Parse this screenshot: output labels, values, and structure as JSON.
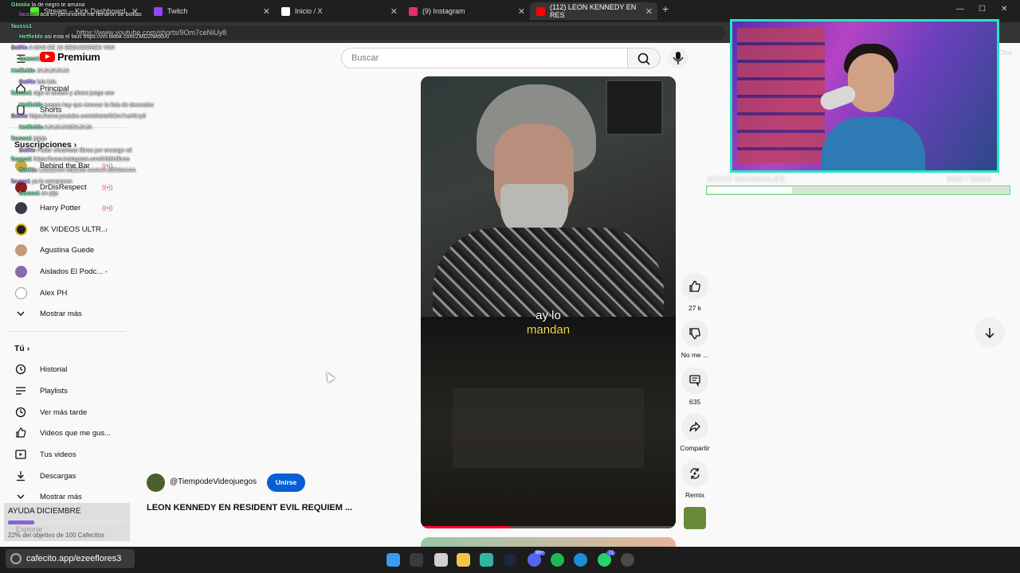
{
  "browser": {
    "tabs": [
      {
        "title": "Stream – Kick Dashboard",
        "color": "#53fc18",
        "active": false
      },
      {
        "title": "Twitch",
        "color": "#9146ff",
        "active": false
      },
      {
        "title": "Inicio / X",
        "color": "#ffffff",
        "active": false
      },
      {
        "title": "(9) Instagram",
        "color": "#e1306c",
        "active": false
      },
      {
        "title": "(112) LEON KENNEDY EN RES",
        "color": "#ff0000",
        "active": true
      }
    ],
    "new_tab": "+",
    "url": "https://www.youtube.com/shorts/9Om7ceNiUy8",
    "chat_label": "Chat"
  },
  "youtube": {
    "logo_text": "Premium",
    "search_placeholder": "Buscar",
    "sidebar": {
      "main": [
        {
          "label": "Principal",
          "icon": "home-icon"
        },
        {
          "label": "Shorts",
          "icon": "shorts-icon"
        }
      ],
      "subscriptions_header": "Suscripciones",
      "subscriptions": [
        {
          "label": "Behind the Bar",
          "avatar_color": "#c8a84a",
          "indicator": "live"
        },
        {
          "label": "DrDisRespect",
          "avatar_color": "#8a2020",
          "indicator": "live"
        },
        {
          "label": "Harry Potter",
          "avatar_color": "#3a3a4a",
          "indicator": "live"
        },
        {
          "label": "8K VIDEOS ULTR...",
          "avatar_color": "#202020",
          "indicator": "dot"
        },
        {
          "label": "Agustina Guede",
          "avatar_color": "#c49a7a",
          "indicator": ""
        },
        {
          "label": "Aislados El Podc...",
          "avatar_color": "#8a6aa8",
          "indicator": "dot"
        },
        {
          "label": "Alex PH",
          "avatar_color": "#ffffff",
          "indicator": ""
        }
      ],
      "show_more_1": "Mostrar más",
      "you_header": "Tú",
      "you": [
        {
          "label": "Historial",
          "icon": "history-icon"
        },
        {
          "label": "Playlists",
          "icon": "playlists-icon"
        },
        {
          "label": "Ver más tarde",
          "icon": "watch-later-icon"
        },
        {
          "label": "Videos que me gus...",
          "icon": "thumbs-up-icon"
        },
        {
          "label": "Tus videos",
          "icon": "your-videos-icon"
        },
        {
          "label": "Descargas",
          "icon": "download-icon"
        }
      ],
      "show_more_2": "Mostrar más",
      "explore_label": "Explorar"
    },
    "short": {
      "subtitle_white": "ay lo",
      "subtitle_yellow": "mandan",
      "channel": "@TiempodeVideojuegos",
      "join_label": "Unirse",
      "title": "LEON KENNEDY EN RESIDENT EVIL REQUIEM ...",
      "progress": 0.35
    },
    "actions": {
      "likes": "27 k",
      "dislike": "No me ...",
      "comments": "635",
      "share": "Compartir",
      "remix": "Remix"
    }
  },
  "stream_overlay": {
    "chat": [
      {
        "user": "Ginniix",
        "text": "la de negro te arruina"
      },
      {
        "user": "fausss1",
        "text": "aca en peronisima me llenaron de bolitas"
      },
      {
        "user": "fausss1",
        "text": ""
      },
      {
        "user": "Hetfieldo",
        "text": "asi esta el faus https://vm.tiktok.com/ZMD2Neb5X/"
      },
      {
        "user": "BotRix",
        "text": "A MAS DE 10 SEGUIDORES YA!!!"
      },
      {
        "user": "fausss1",
        "text": ""
      },
      {
        "user": "Hetfieldo",
        "text": "JAJAJAJAJA"
      },
      {
        "user": "BotRix",
        "text": "lala lala"
      },
      {
        "user": "fausss1",
        "text": "sigo el stream y ahora juego eso"
      },
      {
        "user": "Hetfieldo",
        "text": "juegos hay que renovar la lista de deseados"
      },
      {
        "user": "BotRix",
        "text": "https://www.youtube.com/shorts/9Om7ceNiUy8"
      },
      {
        "user": "Hetfieldo",
        "text": "AJAJAJASDAJAJA"
      },
      {
        "user": "fausss1",
        "text": "jajaja"
      },
      {
        "user": "BotRix",
        "text": "Poder chusmear libros por encargo xd"
      },
      {
        "user": "fausss1",
        "text": "https://www.instagram.com/tribilinlibros"
      },
      {
        "user": "BotRix",
        "text": "LEEEEON MEESS AAAAA GENIAAAA"
      },
      {
        "user": "fausss1",
        "text": "ya lo compraron"
      },
      {
        "user": "fausss1",
        "text": "en pija"
      }
    ],
    "kicks": {
      "label": "KICKS MENSUALES",
      "count": "5584 / 20000",
      "fraction": 0.28
    },
    "donation": {
      "title": "AYUDA DICIEMBRE",
      "subtitle": "22% del objetivo de 100 Cafecitos",
      "fraction": 0.22
    },
    "cafecito": "cafecito.app/ezeeflores3"
  },
  "taskbar": {
    "icons": [
      {
        "name": "windows-start-icon",
        "color": "#3a9bf0"
      },
      {
        "name": "search-taskbar-icon",
        "color": "#3a3a3a"
      },
      {
        "name": "task-view-icon",
        "color": "#d0d0d0"
      },
      {
        "name": "file-explorer-icon",
        "color": "#f4c542"
      },
      {
        "name": "edge-icon",
        "color": "#32b5a8"
      },
      {
        "name": "steam-icon",
        "color": "#1b2838"
      },
      {
        "name": "discord-icon",
        "color": "#5865f2"
      },
      {
        "name": "spotify-icon",
        "color": "#1db954"
      },
      {
        "name": "skype-icon",
        "color": "#1a8fd6"
      },
      {
        "name": "whatsapp-icon",
        "color": "#25d366"
      },
      {
        "name": "obs-icon",
        "color": "#4a4a4a"
      }
    ],
    "discord_badge": "99+",
    "whatsapp_badge": "71"
  }
}
